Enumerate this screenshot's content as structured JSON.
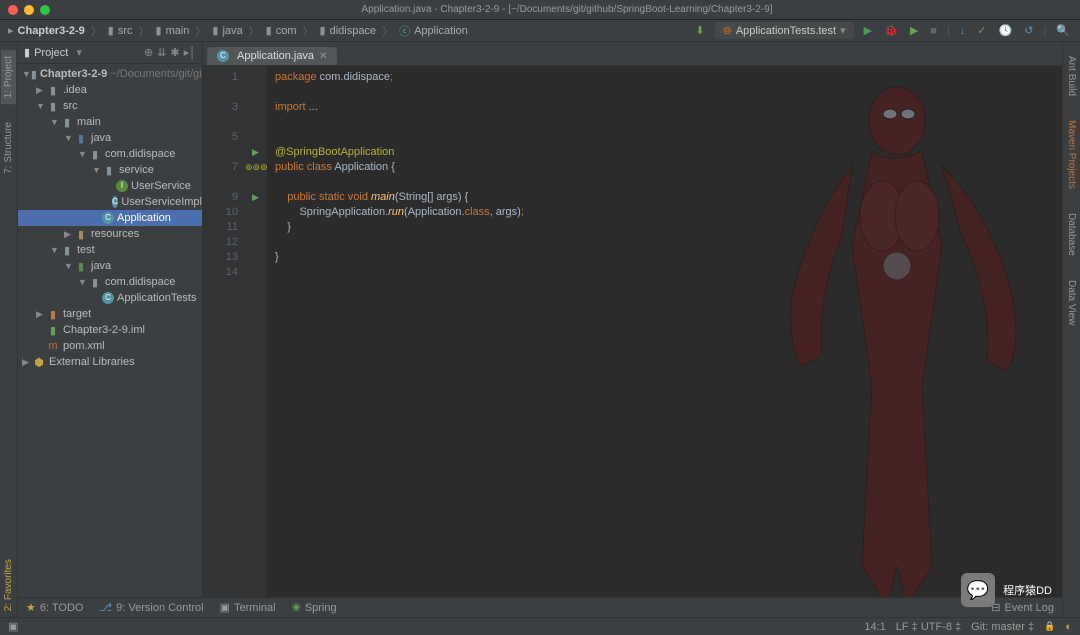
{
  "titlebar": "Application.java - Chapter3-2-9 - [~/Documents/git/github/SpringBoot-Learning/Chapter3-2-9]",
  "breadcrumbs": [
    "Chapter3-2-9",
    "src",
    "main",
    "java",
    "com",
    "didispace",
    "Application"
  ],
  "run_config": "ApplicationTests.test",
  "panel": {
    "title": "Project"
  },
  "tree": {
    "root": "Chapter3-2-9",
    "root_hint": "~/Documents/git/githu",
    "idea": ".idea",
    "src": "src",
    "main": "main",
    "java": "java",
    "pkg": "com.didispace",
    "service": "service",
    "userService": "UserService",
    "userServiceImpl": "UserServiceImpl",
    "application": "Application",
    "resources": "resources",
    "test": "test",
    "javaTest": "java",
    "pkgTest": "com.didispace",
    "appTests": "ApplicationTests",
    "target": "target",
    "iml": "Chapter3-2-9.iml",
    "pom": "pom.xml",
    "ext": "External Libraries"
  },
  "tab": "Application.java",
  "code": {
    "l1": "package com.didispace;",
    "l3": "import ...",
    "l6": "@SpringBootApplication",
    "l7a": "public class ",
    "l7b": "Application {",
    "l9a": "    public static void ",
    "l9b": "main",
    "l9c": "(String[] args) {",
    "l10a": "        SpringApplication.",
    "l10b": "run",
    "l10c": "(Application.",
    "l10d": "class",
    "l10e": ", args);",
    "l11": "    }",
    "l13": "}"
  },
  "gutters": {
    "left": [
      "1: Project",
      "7: Structure"
    ],
    "right": [
      "Ant Build",
      "Maven Projects",
      "Database",
      "Data View"
    ],
    "leftBottom": "2: Favorites"
  },
  "bottom_tabs": [
    "6: TODO",
    "9: Version Control",
    "Terminal",
    "Spring"
  ],
  "event_log": "Event Log",
  "status": {
    "pos": "14:1",
    "enc": "LF ‡  UTF-8 ‡",
    "git": "Git: master ‡"
  },
  "watermark": "程序猿DD"
}
